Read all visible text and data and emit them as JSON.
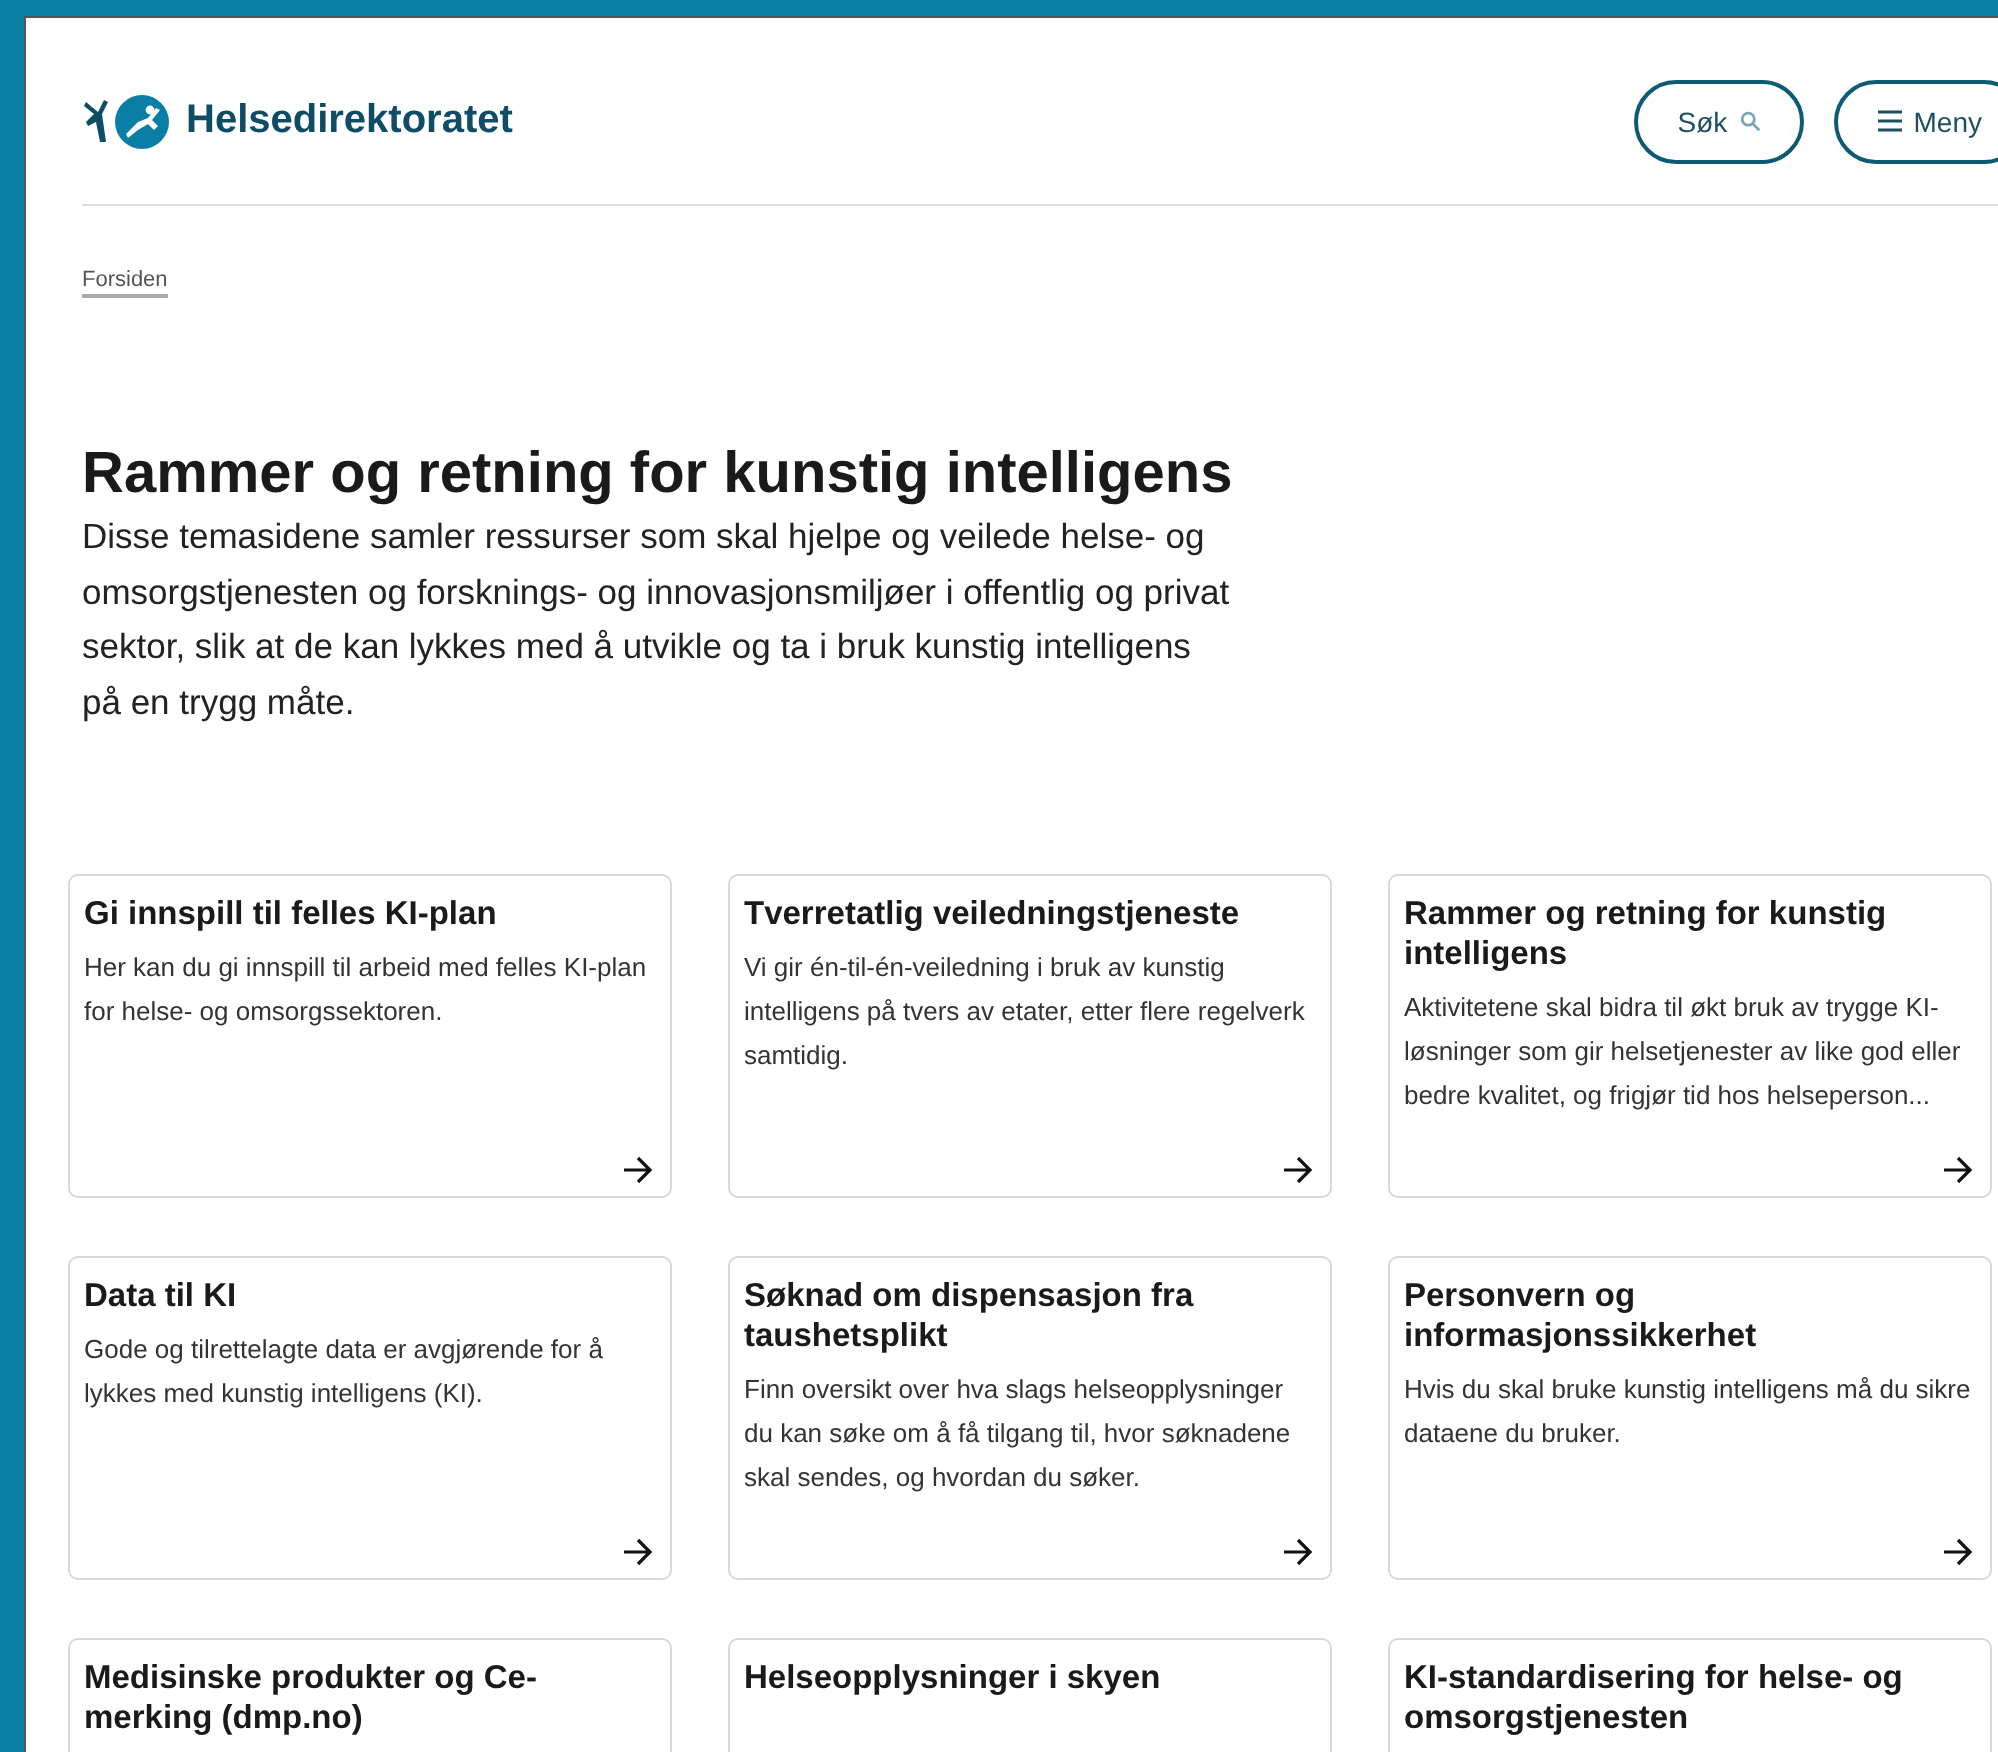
{
  "header": {
    "logo_text": "Helsedirektoratet",
    "buttons": [
      {
        "kind": "search",
        "label": "Søk"
      },
      {
        "kind": "menu",
        "label": "Meny"
      }
    ]
  },
  "breadcrumb": [
    "Forsiden"
  ],
  "title": "Rammer og retning for kunstig intelligens",
  "intro": "Disse temasidene samler ressurser som skal hjelpe og veilede helse- og omsorgstjenesten og forsknings- og innovasjonsmiljøer i offentlig og privat sektor, slik at de kan lykkes med å utvikle og ta i bruk kunstig intelligens på en trygg måte.",
  "cards": [
    {
      "title": "Gi innspill til felles KI-plan",
      "text": "Her kan du gi innspill til arbeid med felles KI-plan for helse- og omsorgssektoren."
    },
    {
      "title": "Tverretatlig veiledningstjeneste",
      "text": "Vi gir én-til-én-veiledning i bruk av kunstig intelligens på tvers av etater, etter flere regelverk samtidig."
    },
    {
      "title": "Rammer og retning for kunstig intelligens",
      "text": "Aktivitetene skal bidra til økt bruk av trygge KI-løsninger som gir helsetjenester av like god eller bedre kvalitet, og frigjør tid hos helseperson..."
    },
    {
      "title": "Data til KI",
      "text": "Gode og tilrettelagte data er avgjørende for å lykkes med kunstig intelligens (KI)."
    },
    {
      "title": "Søknad om dispensasjon fra taushetsplikt",
      "text": "Finn oversikt over hva slags helseopplysninger du kan søke om å få tilgang til, hvor søknadene skal sendes, og hvordan du søker."
    },
    {
      "title": "Personvern og informasjonssikkerhet",
      "text": "Hvis du skal bruke kunstig intelligens må du sikre dataene du bruker."
    },
    {
      "title": "Medisinske produkter og Ce-merking (dmp.no)"
    },
    {
      "title": "Helseopplysninger i skyen"
    },
    {
      "title": "KI-standardisering for helse- og omsorgstjenesten"
    }
  ]
}
